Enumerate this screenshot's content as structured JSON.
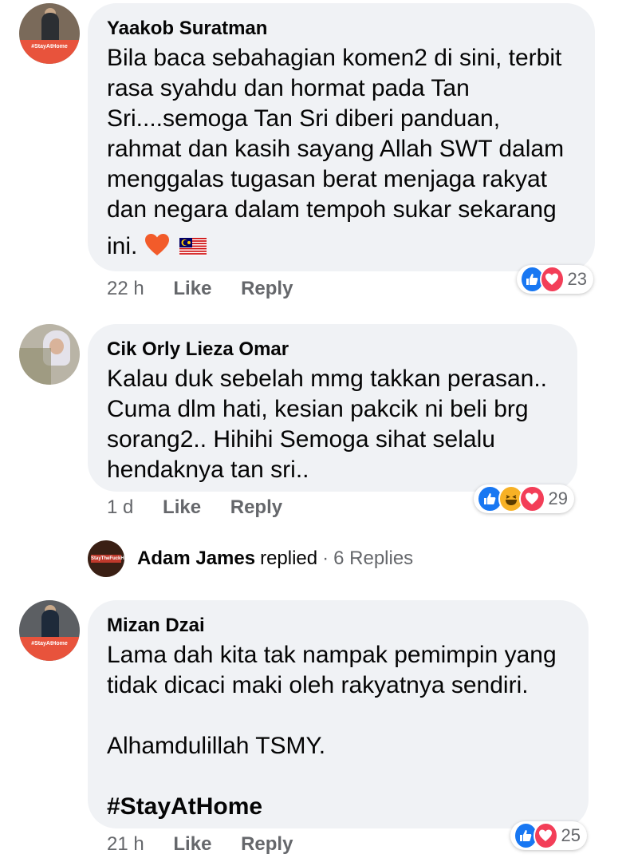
{
  "comments": [
    {
      "author": "Yaakob Suratman",
      "avatar_caption": "#StayAtHome",
      "lines": [
        "Bila baca sebahagian komen2 di sini, terbit",
        "rasa syahdu dan hormat pada Tan",
        "Sri....semoga Tan Sri diberi panduan,",
        "rahmat dan kasih sayang Allah SWT dalam",
        "menggalas tugasan berat menjaga rakyat",
        "dan negara dalam tempoh sukar sekarang",
        "ini."
      ],
      "time": "22 h",
      "like_label": "Like",
      "reply_label": "Reply",
      "reaction_count": "23",
      "reactions": [
        "like",
        "love"
      ]
    },
    {
      "author": "Cik Orly Lieza Omar",
      "lines": [
        "Kalau duk sebelah mmg takkan perasan..",
        "Cuma dlm hati,  kesian pakcik ni beli brg",
        "sorang2.. Hihihi  Semoga sihat selalu",
        "hendaknya tan sri.."
      ],
      "time": "1 d",
      "like_label": "Like",
      "reply_label": "Reply",
      "reaction_count": "29",
      "reactions": [
        "like",
        "haha",
        "love"
      ]
    },
    {
      "author": "Mizan Dzai",
      "avatar_caption": "#StayAtHome",
      "lines": [
        "Lama dah kita tak nampak pemimpin yang",
        "tidak dicaci maki oleh rakyatnya sendiri.",
        "",
        "Alhamdulillah TSMY.",
        "",
        "#StayAtHome"
      ],
      "time": "21 h",
      "like_label": "Like",
      "reply_label": "Reply",
      "reaction_count": "25",
      "reactions": [
        "like",
        "love"
      ]
    }
  ],
  "replied": {
    "name": "Adam James",
    "verb": "replied",
    "separator": "·",
    "count": "6 Replies",
    "avatar_caption": "StayTheFuckHome"
  },
  "colors": {
    "bubble": "#f0f2f5",
    "meta_gray": "#65676b",
    "like_blue": "#1877f2",
    "love_red": "#f33e58",
    "haha_yellow": "#f7b125"
  }
}
